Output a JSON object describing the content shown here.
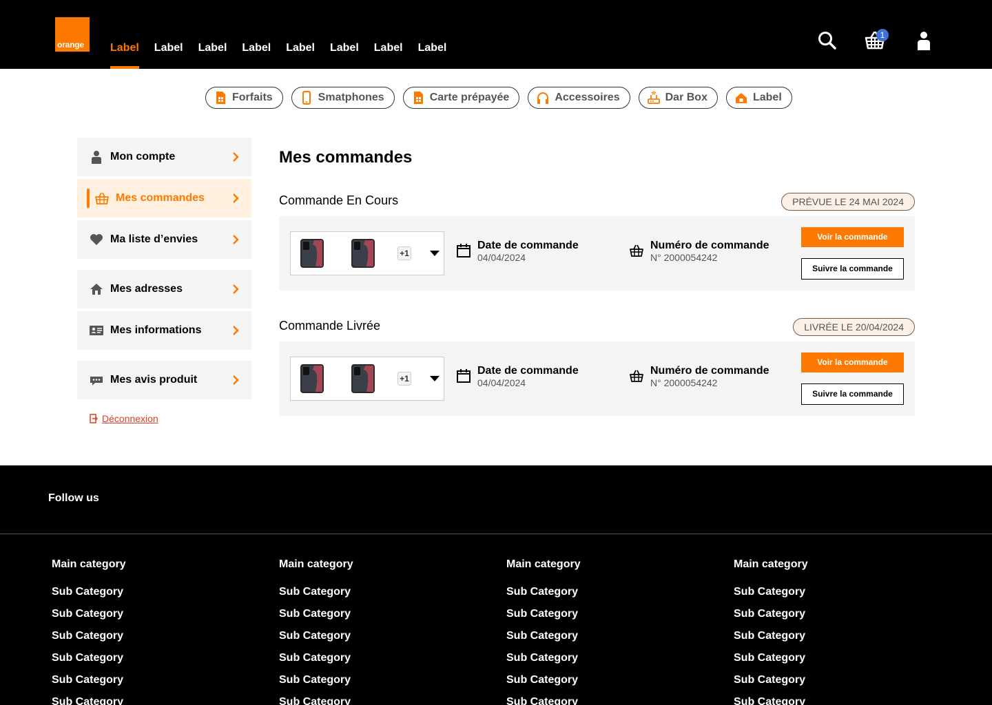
{
  "header": {
    "logo_text": "orange",
    "nav": [
      "Label",
      "Label",
      "Label",
      "Label",
      "Label",
      "Label",
      "Label",
      "Label"
    ],
    "active_nav_index": 0,
    "cart_count": "1",
    "icons": [
      "search-icon",
      "cart-icon",
      "user-icon"
    ]
  },
  "categories": [
    {
      "label": "Forfaits",
      "icon": "sim-card-icon"
    },
    {
      "label": "Smatphones",
      "icon": "smartphone-icon"
    },
    {
      "label": "Carte prépayée",
      "icon": "sim-card-icon"
    },
    {
      "label": "Accessoires",
      "icon": "headphones-icon"
    },
    {
      "label": "Dar Box",
      "icon": "router-icon"
    },
    {
      "label": "Label",
      "icon": "home-icon"
    }
  ],
  "sidebar": {
    "items": [
      {
        "label": "Mon compte",
        "icon": "user-icon"
      },
      {
        "label": "Mes commandes",
        "icon": "basket-icon",
        "active": true
      },
      {
        "label": "Ma liste d’envies",
        "icon": "heart-icon"
      },
      {
        "label": "Mes adresses",
        "icon": "home-icon"
      },
      {
        "label": "Mes informations",
        "icon": "id-card-icon"
      },
      {
        "label": "Mes avis produit",
        "icon": "comment-icon"
      }
    ],
    "logout": "Déconnexion"
  },
  "main": {
    "title": "Mes commandes",
    "orders": [
      {
        "title": "Commande En Cours",
        "badge": "PRÉVUE LE 24 MAI 2024",
        "extra": "+1",
        "date_label": "Date de commande",
        "date_value": "04/04/2024",
        "number_label": "Numéro de commande",
        "number_value": "N° 2000054242",
        "primary_button": "Voir la commande",
        "secondary_button": "Suivre la commande"
      },
      {
        "title": "Commande Livrée",
        "badge": "LIVRÉE LE 20/04/2024",
        "extra": "+1",
        "date_label": "Date de commande",
        "date_value": "04/04/2024",
        "number_label": "Numéro de commande",
        "number_value": "N° 2000054242",
        "primary_button": "Voir la commande",
        "secondary_button": "Suivre la commande"
      }
    ]
  },
  "footer": {
    "follow": "Follow us",
    "columns": [
      {
        "main": "Main category",
        "subs": [
          "Sub Category",
          "Sub Category",
          "Sub Category",
          "Sub Category",
          "Sub Category",
          "Sub Category"
        ]
      },
      {
        "main": "Main category",
        "subs": [
          "Sub Category",
          "Sub Category",
          "Sub Category",
          "Sub Category",
          "Sub Category",
          "Sub Category"
        ]
      },
      {
        "main": "Main category",
        "subs": [
          "Sub Category",
          "Sub Category",
          "Sub Category",
          "Sub Category",
          "Sub Category",
          "Sub Category"
        ]
      },
      {
        "main": "Main category",
        "subs": [
          "Sub Category",
          "Sub Category",
          "Sub Category",
          "Sub Category",
          "Sub Category",
          "Sub Category"
        ]
      }
    ]
  },
  "colors": {
    "accent": "#ff7900",
    "badge": "#4170d8",
    "logout": "#e23b1e"
  }
}
